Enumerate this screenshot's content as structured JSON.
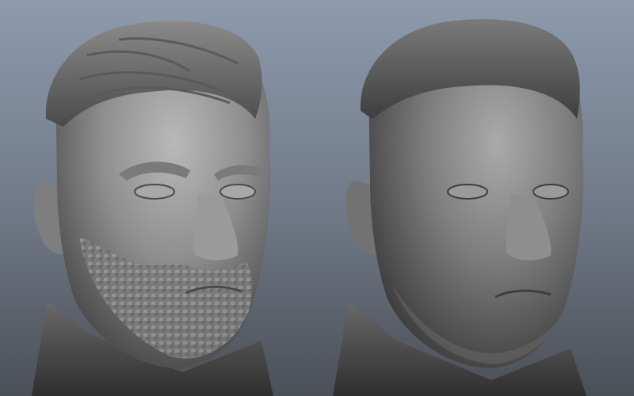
{
  "viewport": {
    "background_top": "#8d9bad",
    "background_bottom": "#4b4f56",
    "mesh_color": "#8a8a8a"
  },
  "models": [
    {
      "label": ""
    },
    {
      "label": ""
    }
  ]
}
